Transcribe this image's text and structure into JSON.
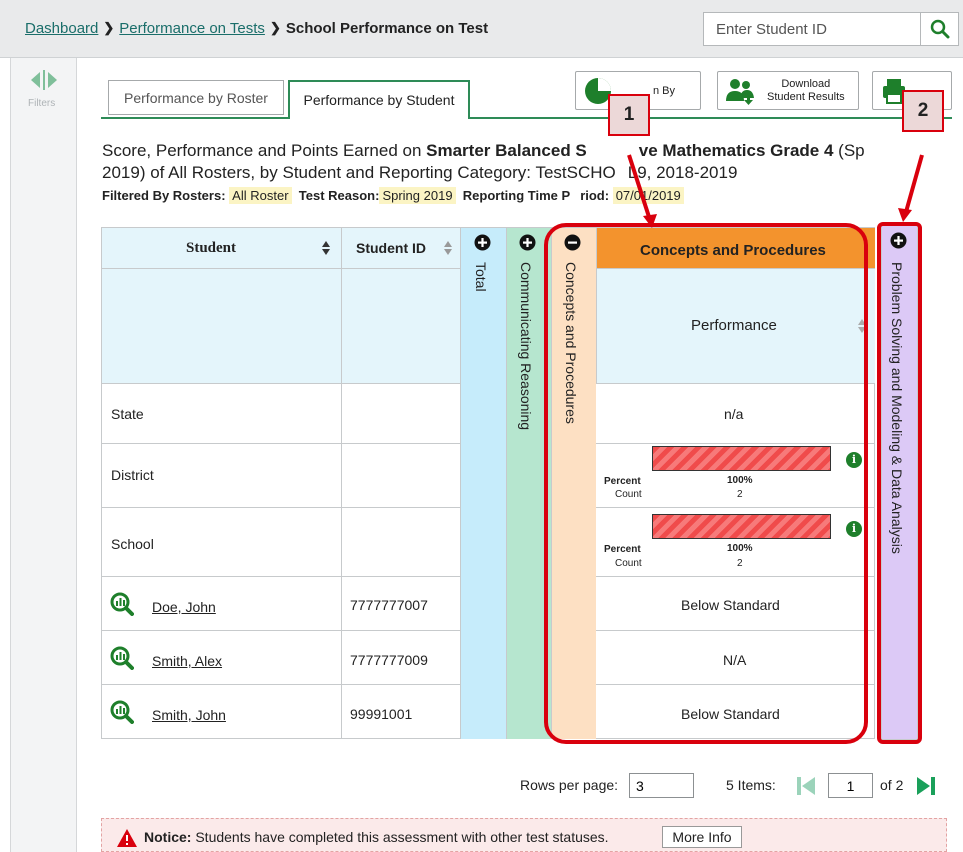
{
  "breadcrumb": {
    "dashboard": "Dashboard",
    "performance_on_tests": "Performance on Tests",
    "current": "School Performance on Test"
  },
  "search": {
    "placeholder": "Enter Student ID"
  },
  "rail": {
    "label": "Filters"
  },
  "tabs": {
    "roster": "Performance by Roster",
    "student": "Performance by Student"
  },
  "toolbar": {
    "breakdown_label": "n By",
    "download_line1": "Download",
    "download_line2": "Student Results"
  },
  "heading": {
    "prefix": "Score, Performance and Points Earned on ",
    "test_bold": "Smarter Balanced S",
    "test_bold2": "ve Mathematics Grade 4",
    "test_suffix": " (Sp",
    "line2": "2019) of All Rosters, by Student and Reporting Category: TestSCHO",
    "line2b": "L9, 2018-2019"
  },
  "filters": {
    "rosters_label": "Filtered By Rosters:",
    "rosters_value": "All Roster",
    "reason_label": "Test Reason:",
    "reason_value": "Spring 2019",
    "period_label": "Reporting Time P",
    "period_label2": "riod:",
    "period_value": "07/01/2019"
  },
  "table": {
    "col_student": "Student",
    "col_student_id": "Student ID",
    "col_total": "Total",
    "col_communicating": "Communicating Reasoning",
    "col_concepts": "Concepts and Procedures",
    "concepts_header": "Concepts and Procedures",
    "performance_header": "Performance",
    "col_problem_solving": "Problem Solving and Modeling & Data Analysis",
    "rows": [
      {
        "name": "State",
        "id": "",
        "performance": "n/a"
      },
      {
        "name": "District",
        "id": "",
        "percent_label": "Percent",
        "percent": "100%",
        "count_label": "Count",
        "count": "2"
      },
      {
        "name": "School",
        "id": "",
        "percent_label": "Percent",
        "percent": "100%",
        "count_label": "Count",
        "count": "2"
      },
      {
        "name": "Doe, John",
        "id": "7777777007",
        "performance": "Below Standard"
      },
      {
        "name": "Smith, Alex",
        "id": "7777777009",
        "performance": "N/A"
      },
      {
        "name": "Smith, John",
        "id": "99991001",
        "performance": "Below Standard"
      }
    ]
  },
  "callouts": {
    "one": "1",
    "two": "2"
  },
  "pagination": {
    "rows_label": "Rows per page:",
    "rows_value": "3",
    "items_label": "5 Items:",
    "page_value": "1",
    "of_label": "of 2"
  },
  "notice": {
    "bold": "Notice:",
    "text": " Students have completed this assessment with other test statuses.",
    "button": "More Info"
  },
  "colors": {
    "accent_green": "#2e8b57",
    "total_col": "#c6ecfb",
    "communicating_col": "#b6e6cf",
    "concepts_col": "#fde0c3",
    "concepts_header": "#f3932d",
    "problem_col": "#dcc9f6",
    "callout_red": "#d9000d"
  }
}
